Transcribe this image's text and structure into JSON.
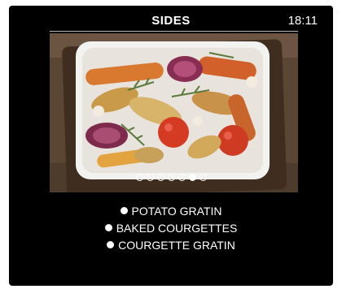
{
  "header": {
    "title": "SIDES",
    "time": "18:11"
  },
  "carousel": {
    "page_count": 7,
    "active_index": 5
  },
  "menu": {
    "items": [
      {
        "label": "POTATO GRATIN"
      },
      {
        "label": "BAKED COURGETTES"
      },
      {
        "label": "COURGETTE GRATIN"
      }
    ]
  }
}
